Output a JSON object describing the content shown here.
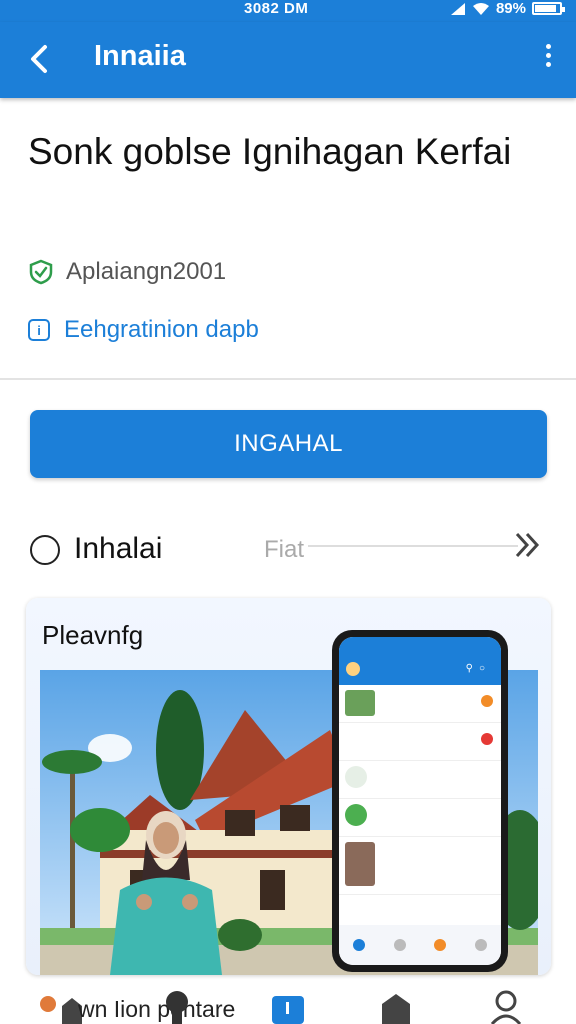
{
  "status_bar": {
    "time": "3082 DM",
    "battery": "89%",
    "battery_level": 0.89
  },
  "app_bar": {
    "title": "Innaiia",
    "back_icon": "arrow-back-icon",
    "menu_icon": "more-vert-icon"
  },
  "app": {
    "headline": "Sonk goblse Ignihagan Kerfai",
    "publisher": "Aplaiangn2001",
    "info_link": "Eehgratinion dapb"
  },
  "install_button": {
    "label": "INGAHAL"
  },
  "option": {
    "label": "Inhalai",
    "filter_label": "Fiat"
  },
  "preview": {
    "title": "Pleavnfg"
  },
  "bottom_nav": {
    "label": "wn Iion  pentare"
  },
  "colors": {
    "accent": "#1c7fd8",
    "verified": "#2e9d4b"
  }
}
